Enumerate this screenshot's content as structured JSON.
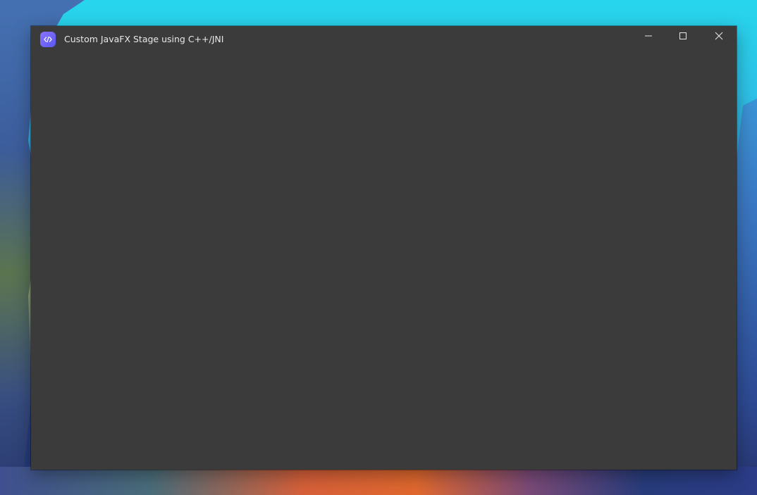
{
  "window": {
    "title": "Custom JavaFX Stage using C++/JNI",
    "app_icon": "code-icon",
    "background_color": "#3b3b3b",
    "accent_color": "#6b63f6"
  },
  "caption_buttons": {
    "minimize": "minimize-icon",
    "maximize": "maximize-icon",
    "close": "close-icon"
  }
}
